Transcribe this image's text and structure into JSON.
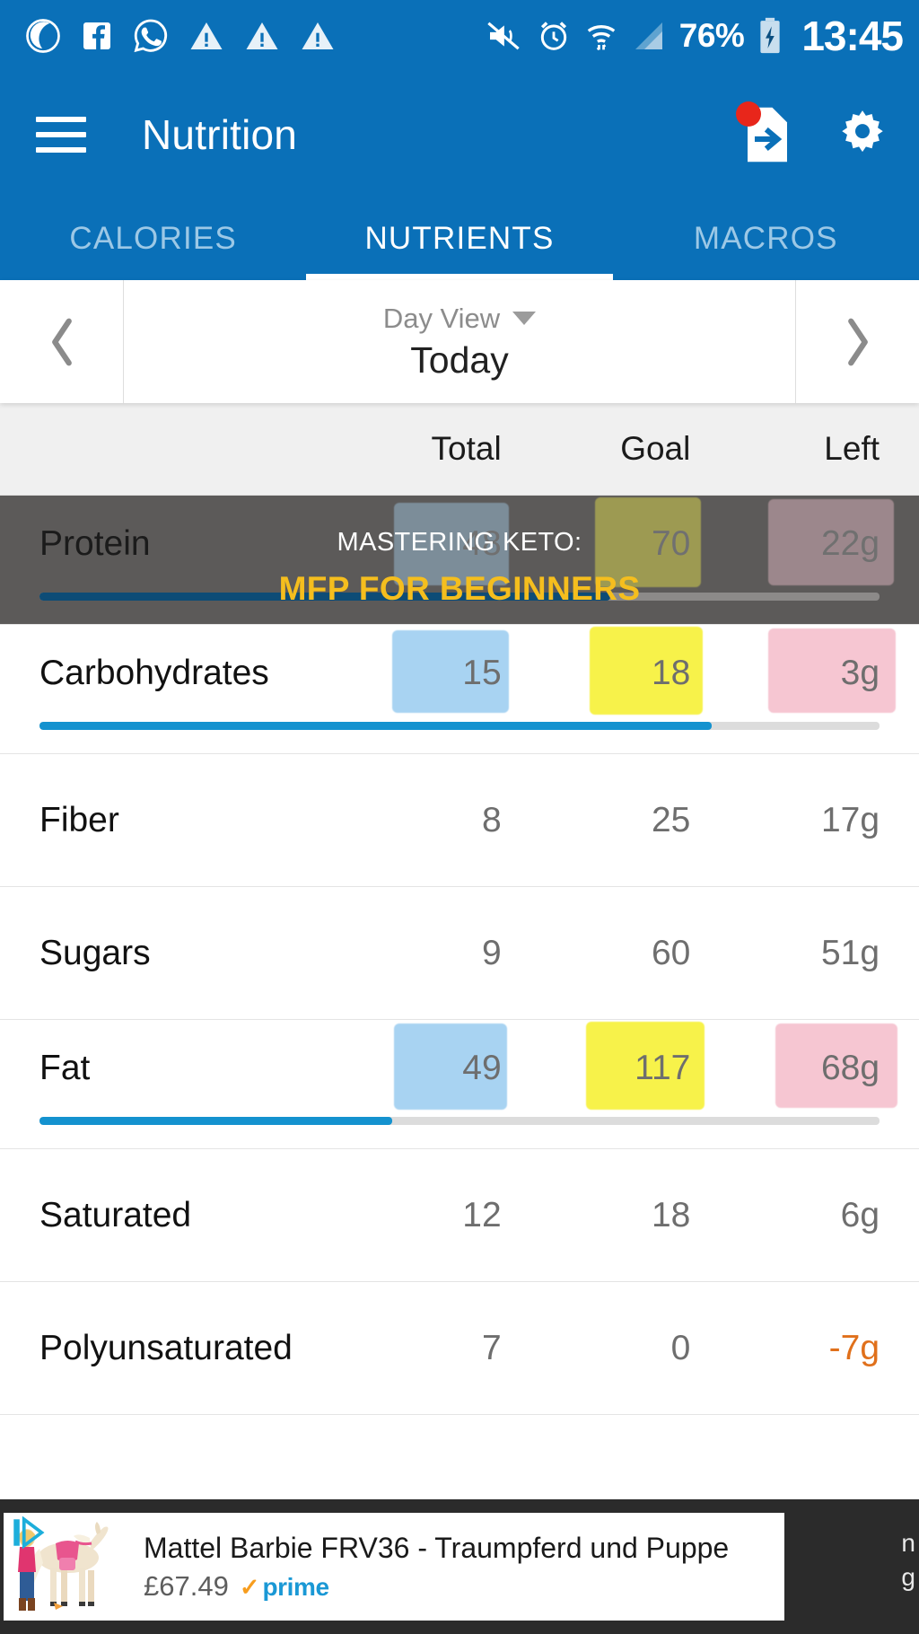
{
  "statusbar": {
    "battery_percent": "76%",
    "clock": "13:45",
    "icons": [
      "moon-icon",
      "facebook-icon",
      "whatsapp-icon",
      "warning-triangle-icon",
      "warning-triangle-icon",
      "warning-triangle-icon",
      "mute-icon",
      "alarm-clock-icon",
      "wifi-icon",
      "signal-icon",
      "battery-charging-icon"
    ]
  },
  "appbar": {
    "title": "Nutrition",
    "menu_icon": "hamburger-icon",
    "export_icon": "export-document-icon",
    "settings_icon": "gear-icon",
    "badge": true
  },
  "tabs": [
    {
      "label": "CALORIES",
      "active": false
    },
    {
      "label": "NUTRIENTS",
      "active": true
    },
    {
      "label": "MACROS",
      "active": false
    }
  ],
  "daybar": {
    "prev_icon": "chevron-left-icon",
    "next_icon": "chevron-right-icon",
    "view_label": "Day View",
    "dropdown_icon": "caret-down-icon",
    "current_day": "Today"
  },
  "table": {
    "headers": {
      "name": "",
      "total": "Total",
      "goal": "Goal",
      "left": "Left"
    },
    "rows": [
      {
        "name": "Protein",
        "total": "48",
        "goal": "70",
        "left": "22g",
        "progress": 68,
        "has_bar": true,
        "highlighted": true,
        "negative": false
      },
      {
        "name": "Carbohydrates",
        "total": "15",
        "goal": "18",
        "left": "3g",
        "progress": 80,
        "has_bar": true,
        "highlighted": true,
        "negative": false
      },
      {
        "name": "Fiber",
        "total": "8",
        "goal": "25",
        "left": "17g",
        "progress": 0,
        "has_bar": false,
        "highlighted": false,
        "negative": false
      },
      {
        "name": "Sugars",
        "total": "9",
        "goal": "60",
        "left": "51g",
        "progress": 0,
        "has_bar": false,
        "highlighted": false,
        "negative": false
      },
      {
        "name": "Fat",
        "total": "49",
        "goal": "117",
        "left": "68g",
        "progress": 42,
        "has_bar": true,
        "highlighted": true,
        "negative": false
      },
      {
        "name": "Saturated",
        "total": "12",
        "goal": "18",
        "left": "6g",
        "progress": 0,
        "has_bar": false,
        "highlighted": false,
        "negative": false
      },
      {
        "name": "Polyunsaturated",
        "total": "7",
        "goal": "0",
        "left": "-7g",
        "progress": 0,
        "has_bar": false,
        "highlighted": false,
        "negative": true
      }
    ]
  },
  "promo_overlay": {
    "line1": "MASTERING KETO:",
    "line2": "MFP FOR BEGINNERS"
  },
  "bottom_ad": {
    "title": "Mattel Barbie FRV36 - Traumpferd und Puppe",
    "price": "£67.49",
    "prime_check": "✓",
    "prime_label": "prime",
    "edge_text_line1": "n",
    "edge_text_line2": "g"
  },
  "colors": {
    "brand_blue": "#0A70B8",
    "progress_blue": "#1492CF",
    "accent_orange": "#E0701B",
    "promo_gold": "#F5BE1E",
    "badge_red": "#E8261B",
    "highlight_blue": "#A8D3F2",
    "highlight_yellow": "#F7F24A",
    "highlight_pink": "#F6C6D2"
  }
}
